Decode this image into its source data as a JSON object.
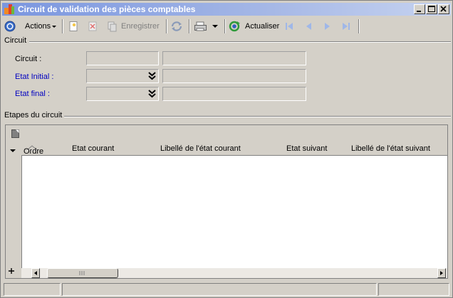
{
  "window": {
    "title": "Circuit de validation des pièces comptables"
  },
  "toolbar": {
    "actions_label": "Actions",
    "save_label": "Enregistrer",
    "refresh_label": "Actualiser"
  },
  "circuit_group": {
    "title": "Circuit",
    "circuit_label": "Circuit :",
    "initial_state_label": "Etat Initial :",
    "final_state_label": "Etat final :"
  },
  "steps_group": {
    "title": "Etapes du circuit",
    "columns": [
      "Ordre",
      "Etat courant",
      "Libellé de l'état courant",
      "Etat suivant",
      "Libellé de l'état suivant"
    ],
    "rows": []
  },
  "colors": {
    "label_blue": "#0000c0",
    "title_gradient_start": "#7a96df"
  }
}
